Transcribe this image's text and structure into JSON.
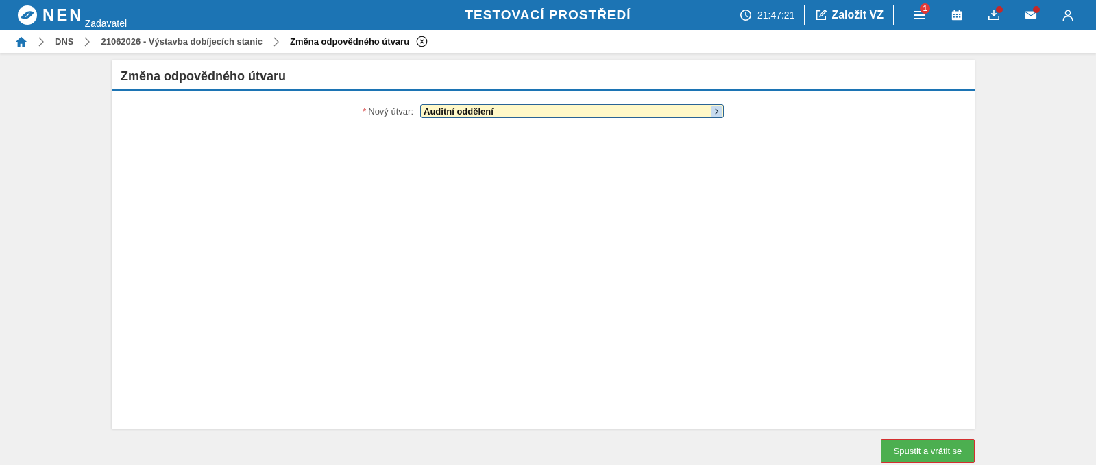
{
  "header": {
    "logo": "NEN",
    "subtitle": "Zadavatel",
    "environment": "TESTOVACÍ PROSTŘEDÍ",
    "time": "21:47:21",
    "create_button": "Založit VZ",
    "icons": [
      {
        "kind": "menu",
        "badge": "1",
        "dot": false
      },
      {
        "kind": "calendar",
        "dot": false
      },
      {
        "kind": "download",
        "dot": true
      },
      {
        "kind": "mail",
        "dot": true
      },
      {
        "kind": "user",
        "dot": false
      }
    ]
  },
  "breadcrumb": [
    {
      "label": "DNS",
      "current": false
    },
    {
      "label": "21062026 - Výstavba dobíjecích stanic",
      "current": false
    },
    {
      "label": "Změna odpovědného útvaru",
      "current": true
    }
  ],
  "form": {
    "title": "Změna odpovědného útvaru",
    "fields": [
      {
        "label": "Nový útvar:",
        "required_mark": "*",
        "value": "Auditní oddělení"
      }
    ]
  },
  "buttons": [
    "Spustit a vrátit se"
  ]
}
